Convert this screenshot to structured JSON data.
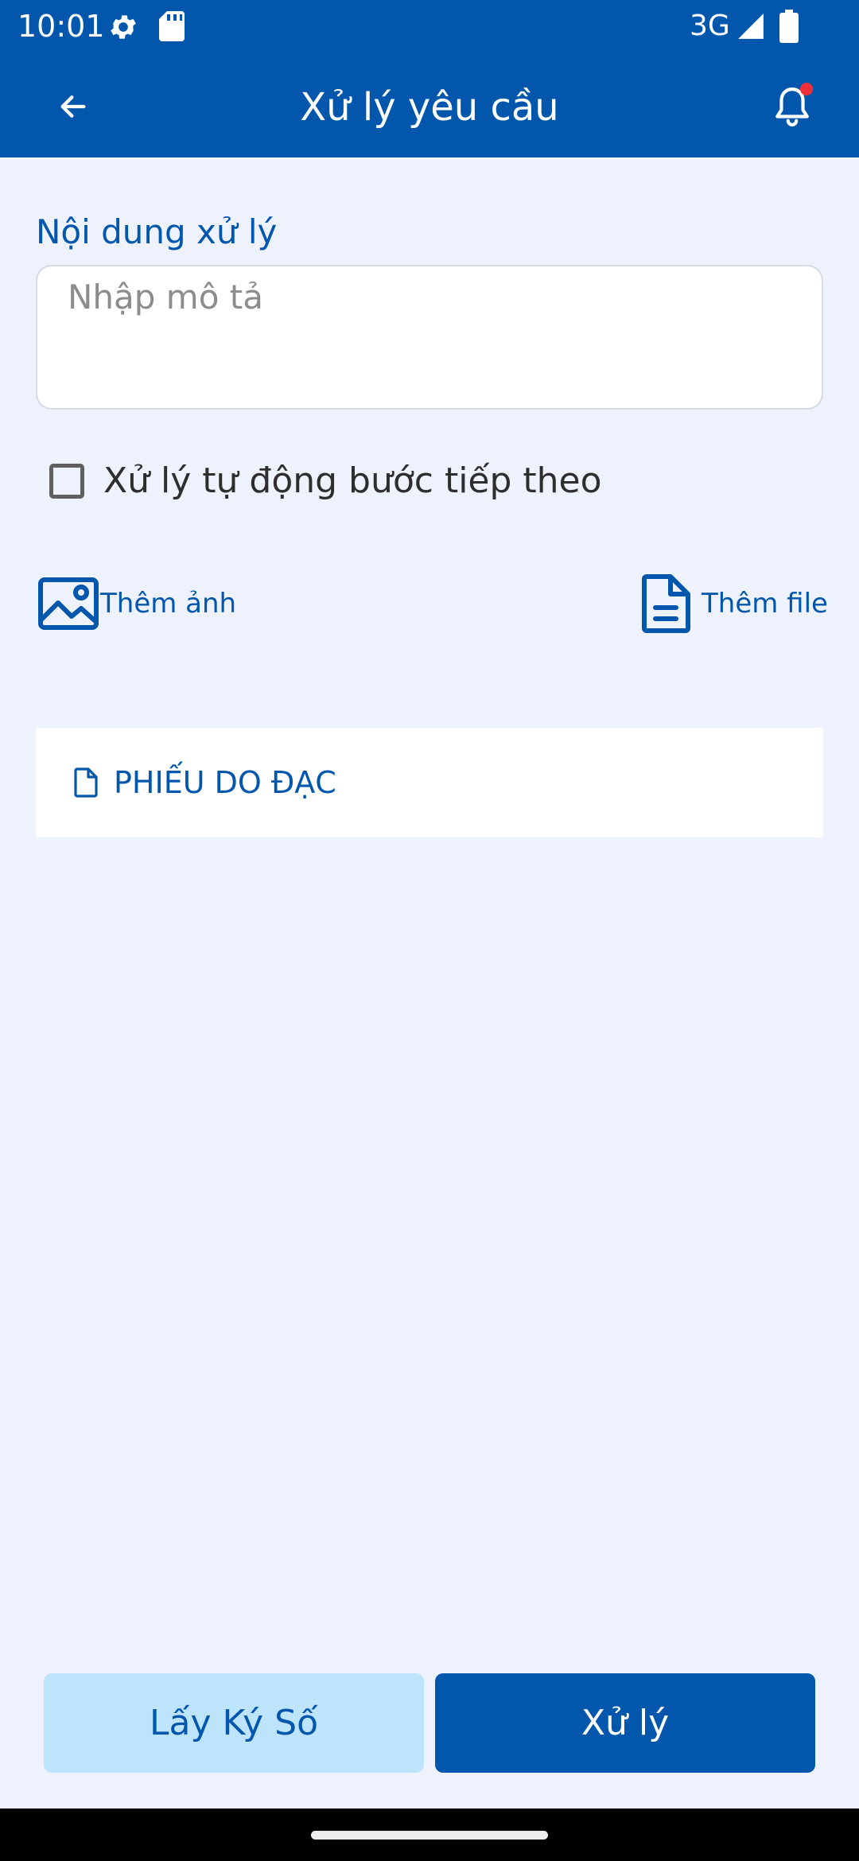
{
  "status_bar": {
    "time": "10:01",
    "network": "3G",
    "icons": [
      "settings-icon",
      "sd-card-icon",
      "signal-icon",
      "battery-icon"
    ]
  },
  "toolbar": {
    "title": "Xử lý yêu cầu",
    "back_icon": "arrow-left-icon",
    "notification_icon": "bell-icon",
    "has_unread": true
  },
  "form": {
    "content_label": "Nội dung xử lý",
    "description": {
      "value": "",
      "placeholder": "Nhập mô tả"
    },
    "auto_next_step": {
      "label": "Xử lý tự động bước tiếp theo",
      "checked": false
    }
  },
  "attachments": {
    "add_image_label": "Thêm ảnh",
    "add_file_label": "Thêm file"
  },
  "documents": [
    {
      "label": "PHIẾU DO ĐẠC",
      "icon": "file-icon"
    }
  ],
  "actions": {
    "sign_label": "Lấy Ký Số",
    "process_label": "Xử lý"
  },
  "colors": {
    "primary": "#0257AC",
    "background": "#EEF2FD",
    "secondary_button": "#BEE4FC",
    "badge": "#F2303A"
  }
}
